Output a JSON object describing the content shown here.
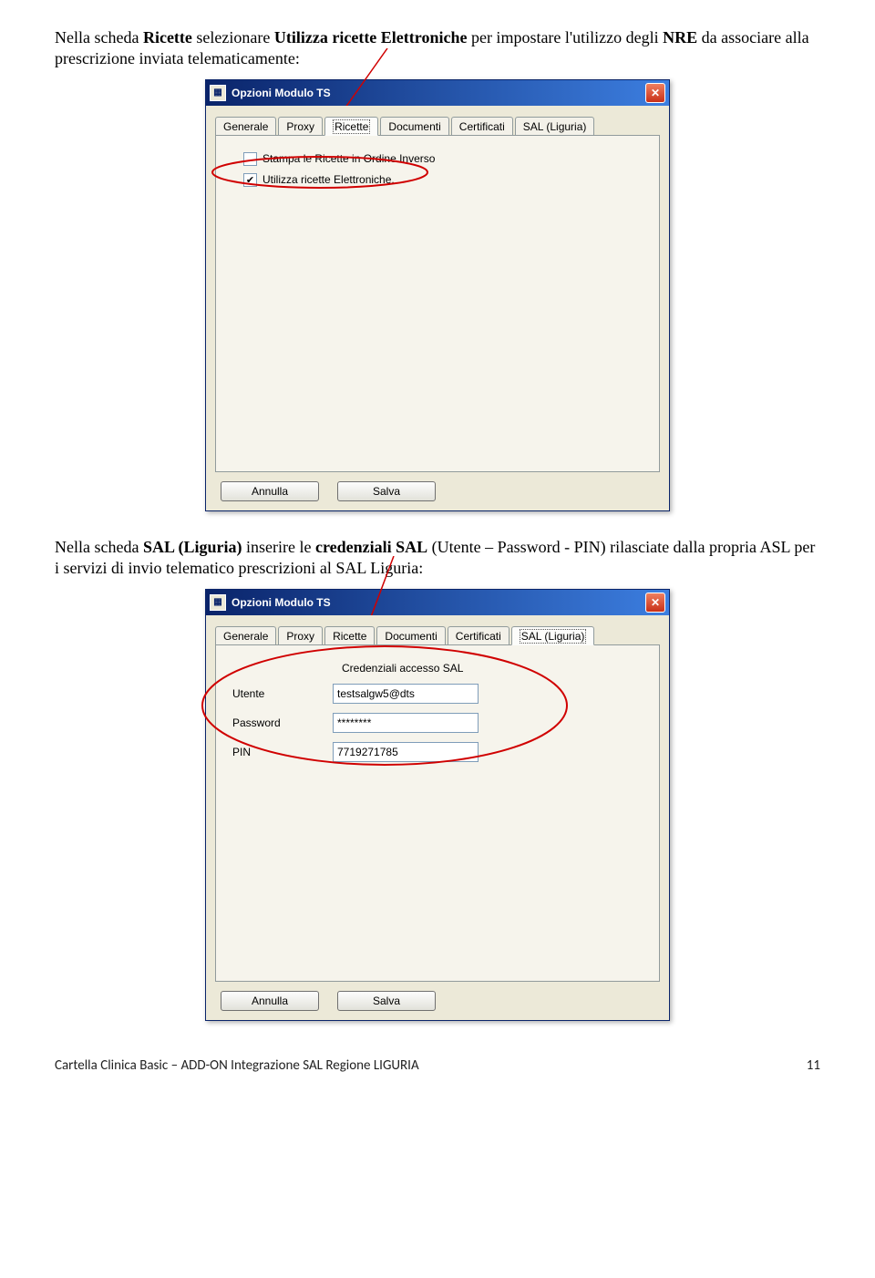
{
  "p1": {
    "part1": "Nella scheda ",
    "bold1": "Ricette",
    "part2": " selezionare ",
    "bold2": "Utilizza ricette Elettroniche",
    "part3": " per impostare l'utilizzo degli ",
    "bold3": "NRE",
    "part4": " da associare alla prescrizione inviata telematicamente:"
  },
  "dialog1": {
    "title": "Opzioni Modulo TS",
    "tabs": [
      "Generale",
      "Proxy",
      "Ricette",
      "Documenti",
      "Certificati",
      "SAL (Liguria)"
    ],
    "activeTabIndex": 2,
    "chk1_label": "Stampa le Ricette in Ordine Inverso",
    "chk1_checked": false,
    "chk2_label": "Utilizza ricette Elettroniche.",
    "chk2_checked": true,
    "btn_annulla": "Annulla",
    "btn_salva": "Salva"
  },
  "p2": {
    "part1": "Nella scheda ",
    "bold1": "SAL (Liguria)",
    "part2": " inserire le ",
    "bold2": "credenziali SAL",
    "part3": " (Utente – Password - PIN) rilasciate dalla propria ASL per i servizi di invio telematico prescrizioni al SAL Liguria:"
  },
  "dialog2": {
    "title": "Opzioni Modulo TS",
    "tabs": [
      "Generale",
      "Proxy",
      "Ricette",
      "Documenti",
      "Certificati",
      "SAL (Liguria)"
    ],
    "activeTabIndex": 5,
    "group_label": "Credenziali accesso SAL",
    "fld_utente_label": "Utente",
    "fld_utente_value": "testsalgw5@dts",
    "fld_password_label": "Password",
    "fld_password_value": "********",
    "fld_pin_label": "PIN",
    "fld_pin_value": "7719271785",
    "btn_annulla": "Annulla",
    "btn_salva": "Salva"
  },
  "footer": {
    "left": "Cartella Clinica Basic – ADD-ON Integrazione SAL Regione LIGURIA",
    "page": "11"
  }
}
